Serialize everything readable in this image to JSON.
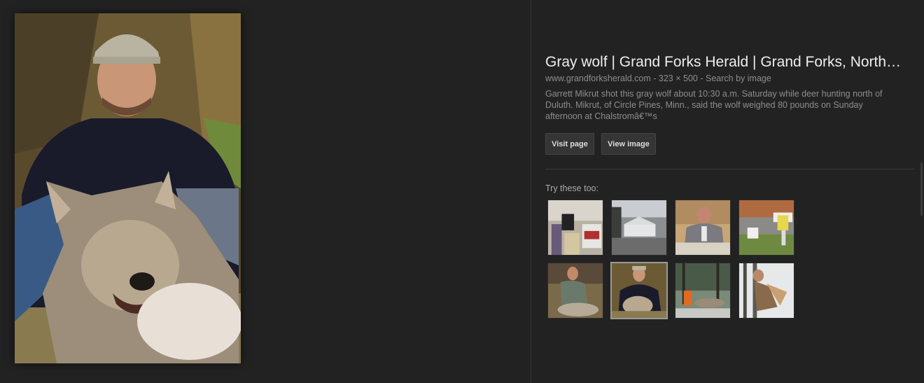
{
  "result": {
    "title": "Gray wolf | Grand Forks Herald | Grand Forks, North…",
    "source": "www.grandforksherald.com",
    "dimensions": "323 × 500",
    "separator": "-",
    "search_by_image": "Search by image",
    "description": "Garrett Mikrut shot this gray wolf about 10:30 a.m. Saturday while deer hunting north of Duluth. Mikrut, of Circle Pines, Minn., said the wolf weighed 80 pounds on Sunday afternoon at Chalstromâ€™s"
  },
  "actions": {
    "visit_page": "Visit page",
    "view_image": "View image"
  },
  "related": {
    "label": "Try these too:",
    "thumbnails": [
      {
        "name": "protest-signs"
      },
      {
        "name": "snowy-cabin"
      },
      {
        "name": "man-in-suit"
      },
      {
        "name": "rally-signs"
      },
      {
        "name": "hunter-with-wolf"
      },
      {
        "name": "smiling-man-with-wolf",
        "selected": true
      },
      {
        "name": "hunter-in-forest"
      },
      {
        "name": "wolf-in-snow"
      }
    ]
  },
  "colors": {
    "background": "#222222",
    "title": "#eeeeee",
    "meta": "#8d8d8d",
    "button_bg": "#353535"
  }
}
